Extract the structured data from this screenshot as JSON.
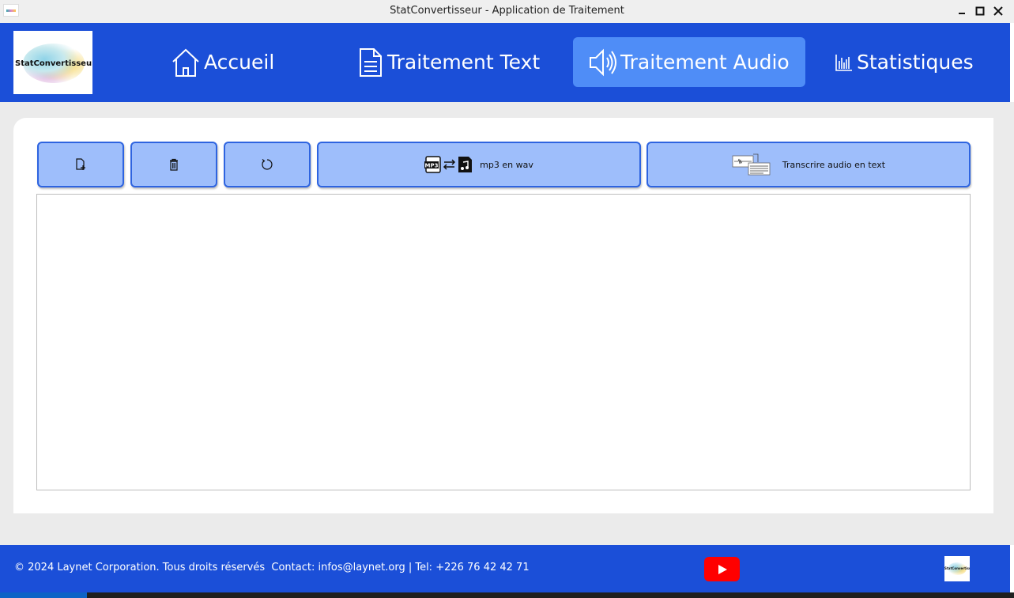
{
  "window": {
    "title": "StatConvertisseur - Application de Traitement"
  },
  "header": {
    "logo_text": "StatConvertisseur",
    "nav": [
      {
        "label": "Accueil",
        "icon": "home-icon",
        "active": false
      },
      {
        "label": "Traitement Text",
        "icon": "document-icon",
        "active": false
      },
      {
        "label": "Traitement Audio",
        "icon": "speaker-icon",
        "active": true
      },
      {
        "label": "Statistiques",
        "icon": "bar-chart-icon",
        "active": false
      }
    ]
  },
  "toolbar": {
    "new_file_icon": "new-file-icon",
    "delete_icon": "trash-icon",
    "refresh_icon": "refresh-icon",
    "convert_label": "mp3 en wav",
    "transcribe_label": "Transcrire audio en text"
  },
  "text_area": {
    "value": ""
  },
  "footer": {
    "copyright": "© 2024 Laynet Corporation. Tous droits réservés  Contact: infos@laynet.org | Tel: +226 76 42 42 71",
    "logo_text": "StatConvertisseur"
  },
  "colors": {
    "brand_blue": "#1b4fd8",
    "active_nav": "#4f8df7",
    "tool_button": "#9ebefb",
    "youtube_red": "#ff0000"
  }
}
